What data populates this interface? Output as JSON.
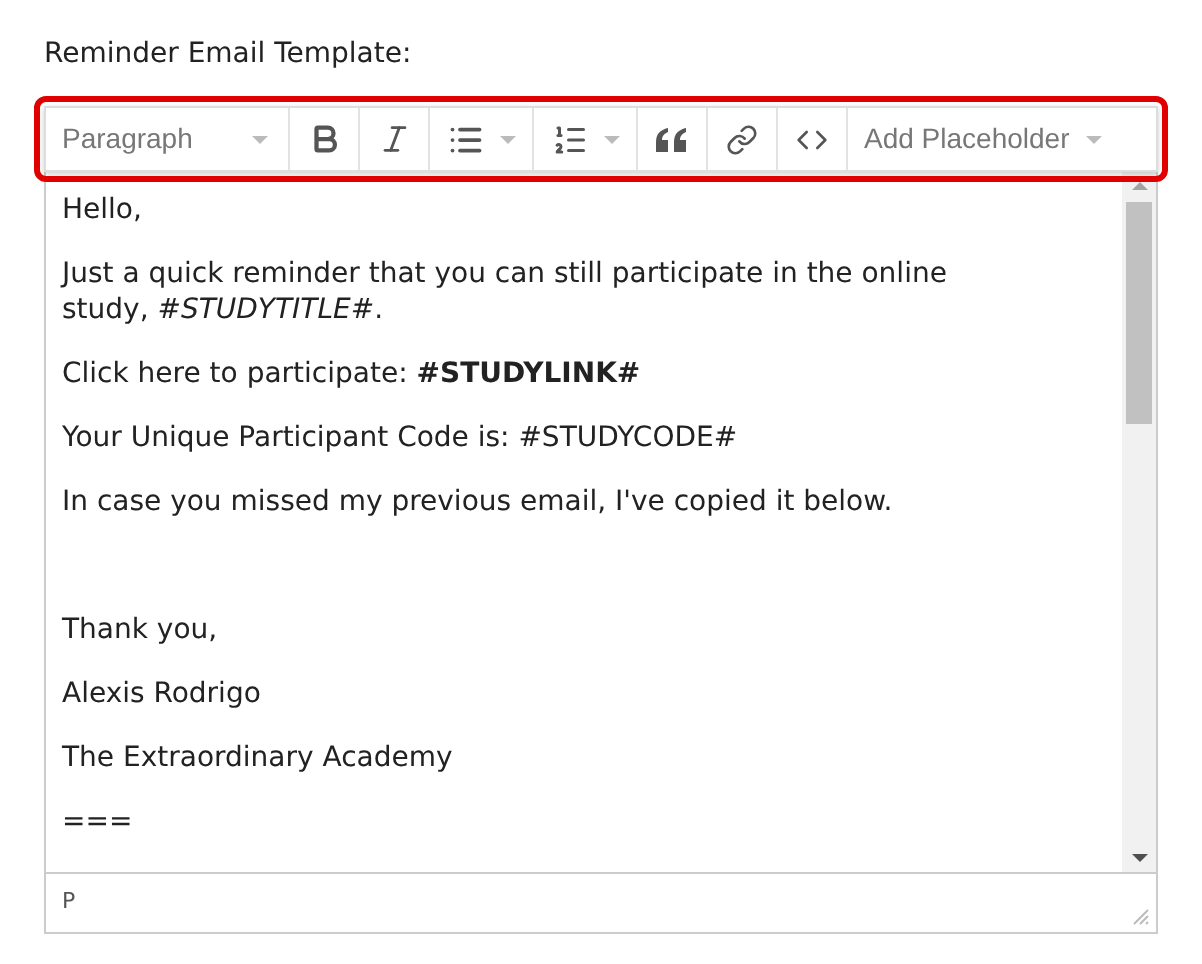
{
  "label": "Reminder Email Template:",
  "toolbar": {
    "block_format": "Paragraph",
    "placeholder_menu": "Add Placeholder",
    "highlighted": true
  },
  "paragraphs": [
    {
      "kind": "text",
      "text": "Hello,"
    },
    {
      "kind": "text",
      "text": "Just a quick reminder that you can still participate in the online study, *#STUDYTITLE#*."
    },
    {
      "kind": "text",
      "text": "Click here to participate: **#STUDYLINK#**"
    },
    {
      "kind": "text",
      "text": "Your Unique Participant Code is: #STUDYCODE#"
    },
    {
      "kind": "text",
      "text": "In case you missed my previous email, I've copied it below."
    },
    {
      "kind": "blank"
    },
    {
      "kind": "text",
      "text": "Thank you,"
    },
    {
      "kind": "text",
      "text": "Alexis Rodrigo"
    },
    {
      "kind": "text",
      "text": "The Extraordinary Academy"
    },
    {
      "kind": "text",
      "text": "==="
    }
  ],
  "status_bar": {
    "path": "P"
  }
}
